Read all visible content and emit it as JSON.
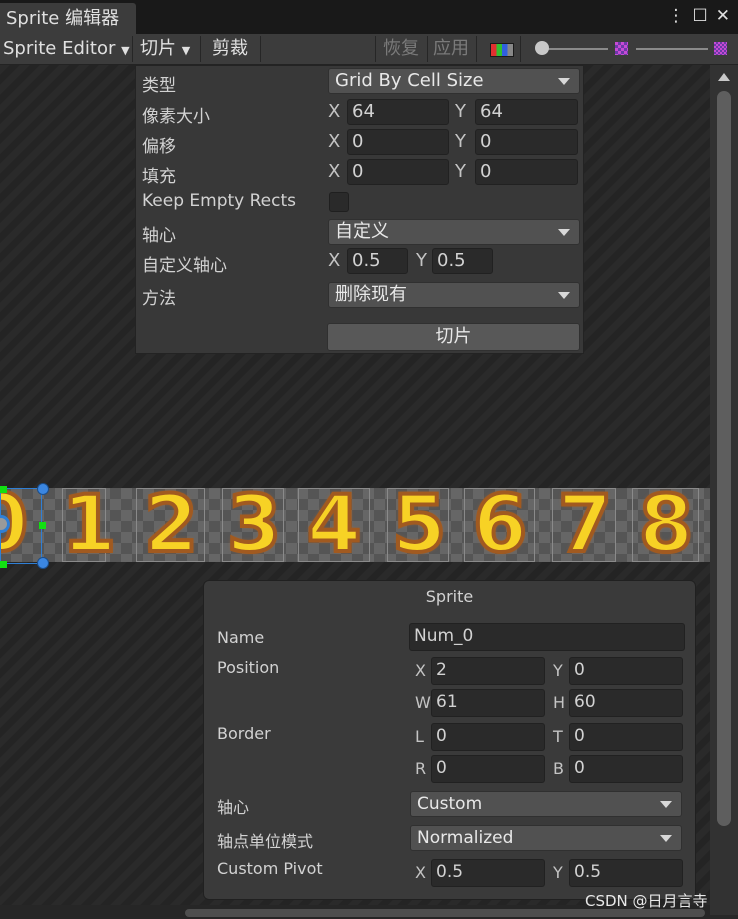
{
  "window": {
    "tab_title": "Sprite 编辑器",
    "menu_icon": "⋮",
    "maximize_icon": "☐",
    "close_icon": "✕"
  },
  "toolbar": {
    "mode_label": "Sprite Editor",
    "slice_label": "切片",
    "trim_label": "剪裁",
    "revert_label": "恢复",
    "apply_label": "应用"
  },
  "slice_panel": {
    "type_label": "类型",
    "type_value": "Grid By Cell Size",
    "pixel_size_label": "像素大小",
    "pixel_size_x": "64",
    "pixel_size_y": "64",
    "offset_label": "偏移",
    "offset_x": "0",
    "offset_y": "0",
    "padding_label": "填充",
    "padding_x": "0",
    "padding_y": "0",
    "keep_empty_label": "Keep Empty Rects",
    "pivot_label": "轴心",
    "pivot_value": "自定义",
    "custom_pivot_label": "自定义轴心",
    "custom_pivot_x": "0.5",
    "custom_pivot_y": "0.5",
    "method_label": "方法",
    "method_value": "删除现有",
    "slice_button": "切片",
    "x": "X",
    "y": "Y"
  },
  "sprites": [
    "0",
    "1",
    "2",
    "3",
    "4",
    "5",
    "6",
    "7",
    "8"
  ],
  "inspector": {
    "title": "Sprite",
    "name_label": "Name",
    "name_value": "Num_0",
    "position_label": "Position",
    "pos_x": "2",
    "pos_y": "0",
    "pos_w": "61",
    "pos_h": "60",
    "border_label": "Border",
    "border_l": "0",
    "border_t": "0",
    "border_r": "0",
    "border_b": "0",
    "pivot_label": "轴心",
    "pivot_value": "Custom",
    "pivot_unit_label": "轴点单位模式",
    "pivot_unit_value": "Normalized",
    "custom_pivot_label": "Custom Pivot",
    "custom_pivot_x": "0.5",
    "custom_pivot_y": "0.5",
    "lbl_x": "X",
    "lbl_y": "Y",
    "lbl_w": "W",
    "lbl_h": "H",
    "lbl_l": "L",
    "lbl_t": "T",
    "lbl_r": "R",
    "lbl_b": "B"
  },
  "watermark": "CSDN @日月言寺"
}
